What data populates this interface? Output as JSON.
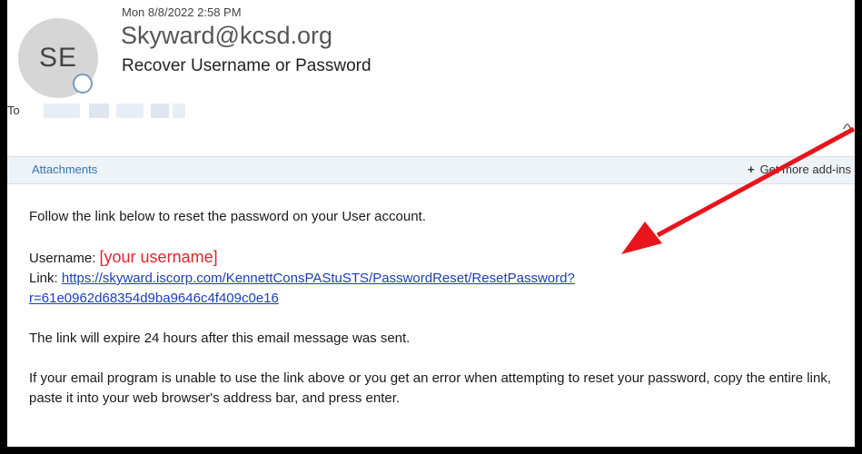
{
  "email": {
    "avatar_initials": "SE",
    "date": "Mon 8/8/2022 2:58 PM",
    "sender": "Skyward@kcsd.org",
    "subject": "Recover Username or Password",
    "to_label": "To"
  },
  "attachments_bar": {
    "label": "Attachments",
    "addins_label": "Get more add-ins",
    "addins_icon": "plus-icon"
  },
  "body": {
    "intro": "Follow the link below to reset the password on your User account.",
    "username_label": "Username: ",
    "username_value": "[your username]",
    "link_label": "Link: ",
    "link_line1": "https://skyward.iscorp.com/KennettConsPAStuSTS/PasswordReset/ResetPassword?",
    "link_line2": "r=61e0962d68354d9ba9646c4f409c0e16",
    "expire": "The link will expire 24 hours after this email message was sent.",
    "instructions": "If your email program is unable to use the link above or you get an error when attempting to reset your password, copy the entire link, paste it into your web browser's address bar, and press enter."
  },
  "colors": {
    "annotation_arrow": "#e8141c",
    "link": "#1a3fb8",
    "username_highlight": "#e0252e"
  }
}
